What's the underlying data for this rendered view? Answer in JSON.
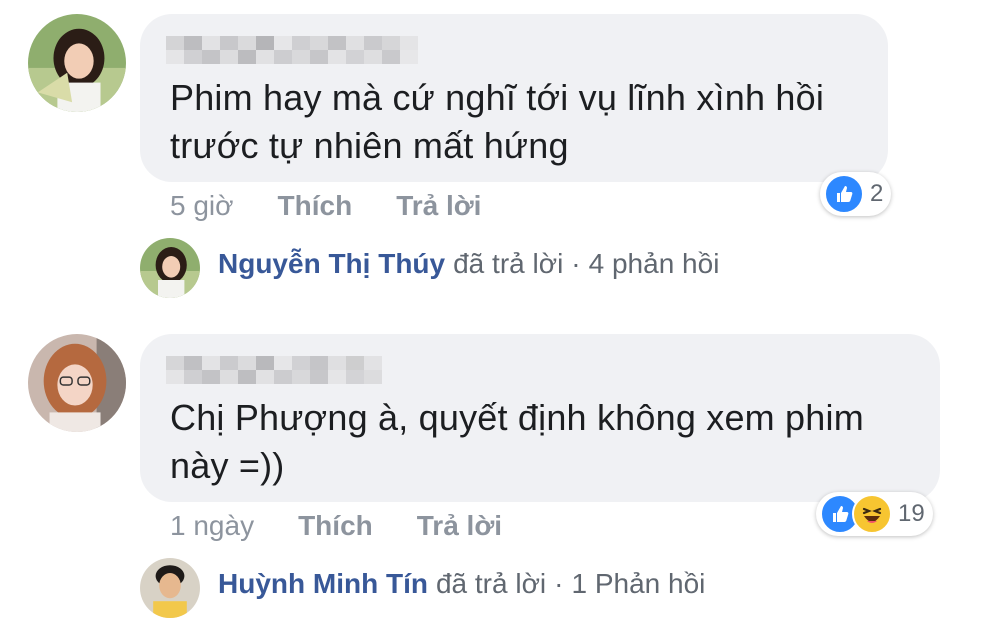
{
  "comments": [
    {
      "text": "Phim hay mà cứ nghĩ tới vụ lĩnh xình hồi\ntrước tự nhiên mất hứng",
      "time": "5 giờ",
      "like_label": "Thích",
      "reply_label": "Trả lời",
      "reaction_count": "2",
      "reactions": [
        "like-icon"
      ],
      "reply": {
        "name": "Nguyễn Thị Thúy",
        "action": "đã trả lời",
        "separator": "·",
        "count": "4 phản hồi"
      }
    },
    {
      "text": "Chị Phượng à, quyết định không xem phim\nnày =))",
      "time": "1 ngày",
      "like_label": "Thích",
      "reply_label": "Trả lời",
      "reaction_count": "19",
      "reactions": [
        "like-icon",
        "haha-icon"
      ],
      "reply": {
        "name": "Huỳnh Minh Tín",
        "action": "đã trả lời",
        "separator": "·",
        "count": "1 Phản hồi"
      }
    }
  ],
  "colors": {
    "bubble": "#f0f1f4",
    "name_link": "#385898",
    "meta": "#8d949e",
    "like_blue": "#2d88ff",
    "haha_yellow": "#f7c531"
  }
}
